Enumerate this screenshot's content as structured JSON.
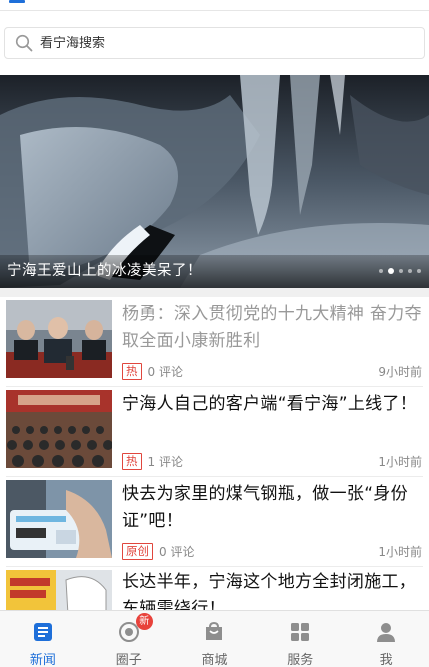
{
  "search": {
    "placeholder": "看宁海搜索"
  },
  "banner": {
    "caption": "宁海王爱山上的冰凌美呆了！",
    "dots_count": 5,
    "active_dot": 1
  },
  "news": [
    {
      "title": "杨勇：深入贯彻党的十九大精神 奋力夺取全面小康新胜利",
      "tag": "",
      "comments": "",
      "time": "",
      "read": true,
      "tag_top": "热",
      "comments_top": "0 评论",
      "time_top": "9小时前"
    },
    {
      "title": "宁海人自己的客户端“看宁海”上线了！",
      "tag": "热",
      "comments": "1 评论",
      "time": "1小时前",
      "read": false
    },
    {
      "title": "快去为家里的煤气钢瓶，做一张“身份证”吧！",
      "tag": "原创",
      "comments": "0 评论",
      "time": "1小时前",
      "read": false
    },
    {
      "title": "长达半年，宁海这个地方全封闭施工，车辆需绕行！",
      "tag": "",
      "comments": "",
      "time": "",
      "read": false
    }
  ],
  "item1_meta": {
    "tag": "热",
    "comments": "0 评论",
    "time": "9小时前"
  },
  "tabs": [
    {
      "label": "新闻",
      "icon": "news-icon",
      "active": true
    },
    {
      "label": "圈子",
      "icon": "circle-icon",
      "badge": "新"
    },
    {
      "label": "商城",
      "icon": "shop-icon"
    },
    {
      "label": "服务",
      "icon": "service-grid-icon"
    },
    {
      "label": "我",
      "icon": "user-icon"
    }
  ],
  "colors": {
    "accent": "#1e6fd9",
    "hot_tag": "#e0463d",
    "badge": "#e8423b"
  }
}
